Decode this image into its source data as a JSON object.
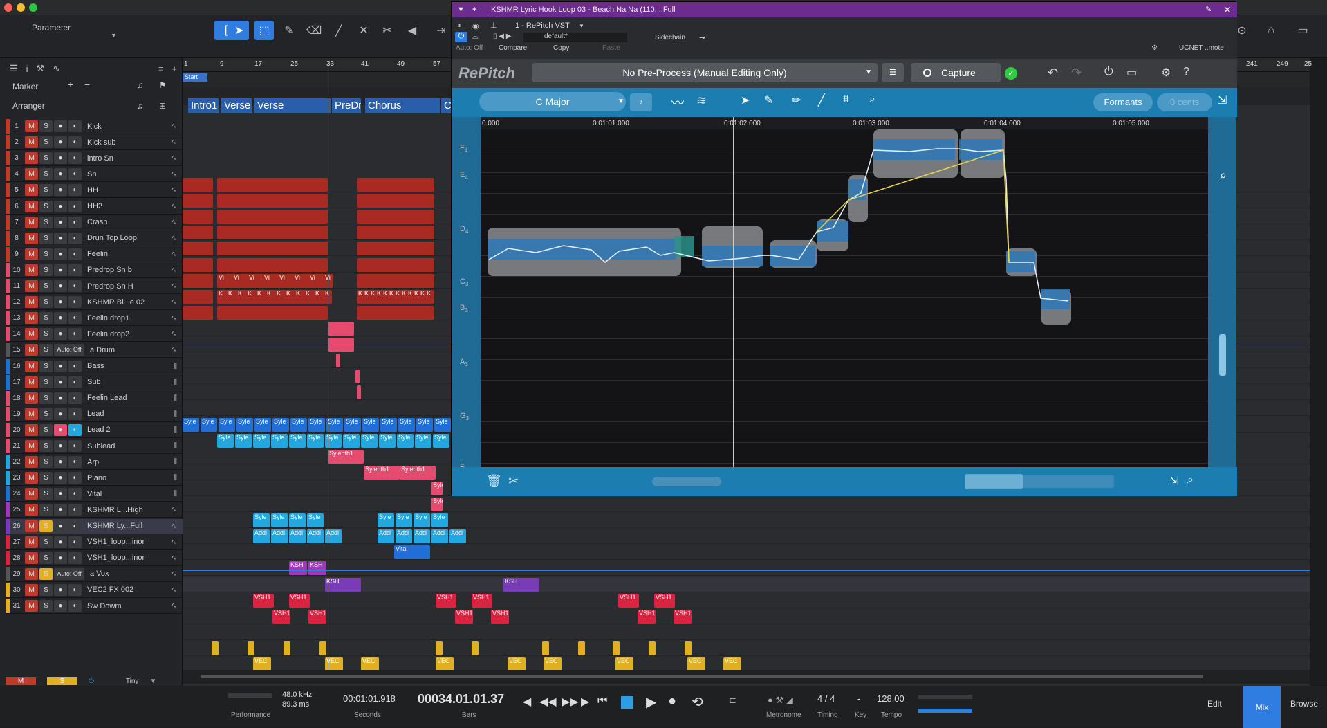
{
  "titlebar": {
    "colors": {
      "close": "#fe5f57",
      "min": "#febc2e",
      "max": "#28c840"
    }
  },
  "toolbar": {
    "parameter_label": "Parameter"
  },
  "left_panel": {
    "marker_label": "Marker",
    "arranger_label": "Arranger",
    "footer_mute": "M",
    "footer_solo": "S",
    "footer_size": "Tiny"
  },
  "tracks": [
    {
      "num": "1",
      "name": "Kick",
      "color": "#c0392b"
    },
    {
      "num": "2",
      "name": "Kick sub",
      "color": "#c0392b"
    },
    {
      "num": "3",
      "name": "intro Sn",
      "color": "#c0392b"
    },
    {
      "num": "4",
      "name": "Sn",
      "color": "#c0392b"
    },
    {
      "num": "5",
      "name": "HH",
      "color": "#c0392b"
    },
    {
      "num": "6",
      "name": "HH2",
      "color": "#c0392b"
    },
    {
      "num": "7",
      "name": "Crash",
      "color": "#c0392b"
    },
    {
      "num": "8",
      "name": "Drun Top Loop",
      "color": "#c0392b"
    },
    {
      "num": "9",
      "name": "Feelin",
      "color": "#c0392b"
    },
    {
      "num": "10",
      "name": "Predrop Sn b",
      "color": "#e44b6e"
    },
    {
      "num": "11",
      "name": "Predrop Sn H",
      "color": "#e44b6e"
    },
    {
      "num": "12",
      "name": "KSHMR Bi...e 02",
      "color": "#e44b6e"
    },
    {
      "num": "13",
      "name": "Feelin drop1",
      "color": "#e44b6e"
    },
    {
      "num": "14",
      "name": "Feelin drop2",
      "color": "#e44b6e"
    },
    {
      "num": "15",
      "name": "a Drum",
      "color": "#555",
      "auto": "Auto: Off"
    },
    {
      "num": "16",
      "name": "Bass",
      "color": "#1f6fd6"
    },
    {
      "num": "17",
      "name": "Sub",
      "color": "#1f6fd6"
    },
    {
      "num": "18",
      "name": "Feelin Lead",
      "color": "#e44b6e"
    },
    {
      "num": "19",
      "name": "Lead",
      "color": "#e44b6e"
    },
    {
      "num": "20",
      "name": "Lead 2",
      "color": "#e44b6e"
    },
    {
      "num": "21",
      "name": "Sublead",
      "color": "#e44b6e"
    },
    {
      "num": "22",
      "name": "Arp",
      "color": "#22a8e0"
    },
    {
      "num": "23",
      "name": "Piano",
      "color": "#22a8e0"
    },
    {
      "num": "24",
      "name": "Vital",
      "color": "#1f6fd6"
    },
    {
      "num": "25",
      "name": "KSHMR L...High",
      "color": "#9b3bb8"
    },
    {
      "num": "26",
      "name": "KSHMR Ly...Full",
      "color": "#7a3bb8"
    },
    {
      "num": "27",
      "name": "VSH1_loop...inor",
      "color": "#d9233f"
    },
    {
      "num": "28",
      "name": "VSH1_loop...inor",
      "color": "#d9233f"
    },
    {
      "num": "29",
      "name": "a Vox",
      "color": "#555",
      "auto": "Auto: Off"
    },
    {
      "num": "30",
      "name": "VEC2 FX 002",
      "color": "#e0b020"
    },
    {
      "num": "31",
      "name": "Sw Dowm",
      "color": "#e0b020"
    }
  ],
  "ruler": {
    "bars": [
      "1",
      "9",
      "17",
      "25",
      "33",
      "41",
      "49",
      "57",
      "241",
      "249",
      "25"
    ],
    "start_label": "Start"
  },
  "arranger_sections": [
    "Intro1",
    "Verse",
    "Verse",
    "PreDr",
    "Chorus",
    "Ch"
  ],
  "clip_labels": {
    "vi": "Vi",
    "k": "K",
    "sylenth": "Sylenth1",
    "syle": "Syle",
    "addi": "Addi",
    "add": "Add",
    "ad": "Ad",
    "vital": "Vital",
    "ksh": "KSH",
    "vsh": "VSH1",
    "vec": "VEC"
  },
  "plugin": {
    "title": "KSHMR Lyric Hook Loop 03 - Beach Na Na (110, ..Full",
    "instance": "1 - RePitch VST",
    "preset": "default*",
    "compare": "Compare",
    "copy": "Copy",
    "paste": "Paste",
    "sidechain": "Sidechain",
    "auto_off": "Auto: Off",
    "remote": "UCNET ..mote",
    "logo": "RePitch",
    "preprocess": "No Pre-Process (Manual Editing Only)",
    "capture": "Capture",
    "key": "C Major",
    "formants": "Formants",
    "cents": "0 cents",
    "time_labels": [
      "0.000",
      "0:01:01.000",
      "0:01:02.000",
      "0:01:03.000",
      "0:01:04.000",
      "0:01:05.000"
    ],
    "notes": [
      {
        "name": "F",
        "oct": "4"
      },
      {
        "name": "E",
        "oct": "4"
      },
      {
        "name": "D",
        "oct": "4"
      },
      {
        "name": "C",
        "oct": "3"
      },
      {
        "name": "B",
        "oct": "3"
      },
      {
        "name": "A",
        "oct": "3"
      },
      {
        "name": "G",
        "oct": "3"
      },
      {
        "name": "F",
        "oct": ""
      }
    ],
    "colors": {
      "panel": "#1b7db0",
      "note": "#2e78b8",
      "pitch": "#e8d84a"
    }
  },
  "transport": {
    "sample_rate": "48.0 kHz",
    "latency": "89.3 ms",
    "performance": "Performance",
    "time": "00:01:01.918",
    "time_unit": "Seconds",
    "bars": "00034.01.01.37",
    "bars_unit": "Bars",
    "metronome": "Metronome",
    "timing_value": "4 / 4",
    "timing": "Timing",
    "key_value": "-",
    "key": "Key",
    "tempo_value": "128.00",
    "tempo": "Tempo",
    "edit": "Edit",
    "mix": "Mix",
    "browse": "Browse"
  }
}
